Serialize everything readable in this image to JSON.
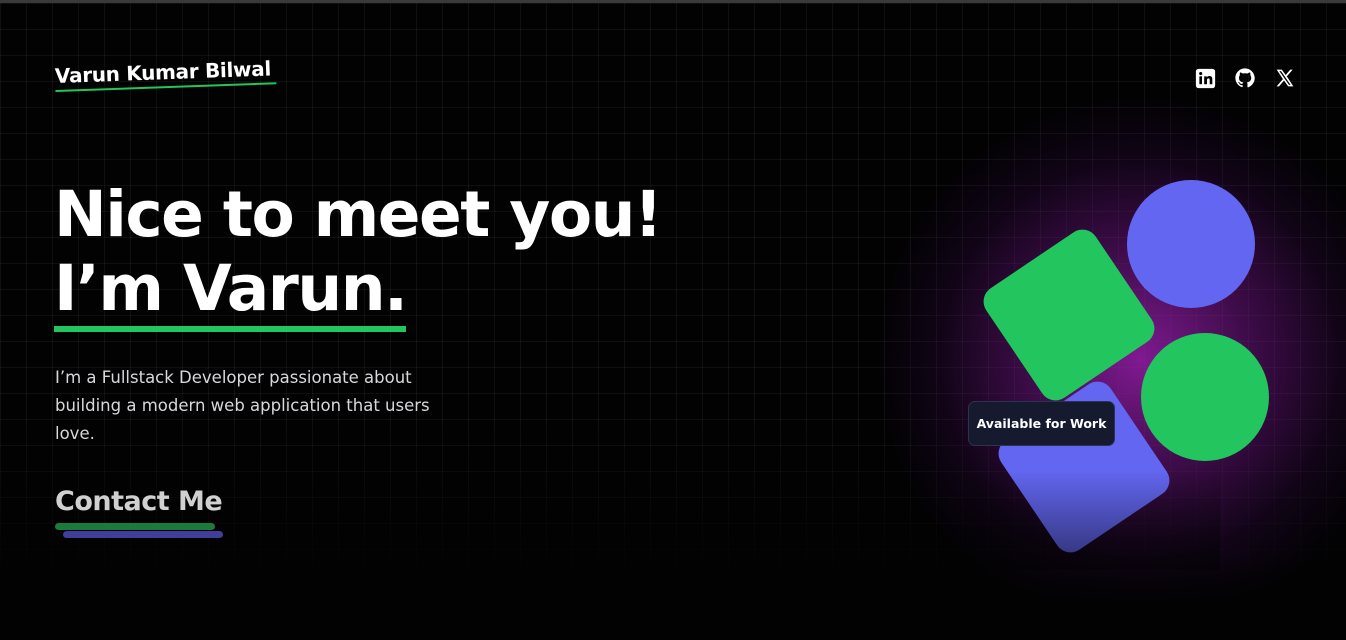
{
  "header": {
    "brand": "Varun Kumar Bilwal",
    "socials": [
      {
        "icon": "linkedin-icon"
      },
      {
        "icon": "github-icon"
      },
      {
        "icon": "x-twitter-icon"
      }
    ]
  },
  "hero": {
    "headline_line1": "Nice to meet you!",
    "headline_line2": "I’m Varun.",
    "intro": "I’m a Fullstack Developer passionate about building a modern web application that users love.",
    "cta_label": "Contact Me"
  },
  "badge": {
    "label": "Available for Work"
  },
  "colors": {
    "accent_green": "#22c55e",
    "accent_purple": "#6366f1",
    "glow_magenta": "#961eaa",
    "background": "#020203"
  }
}
